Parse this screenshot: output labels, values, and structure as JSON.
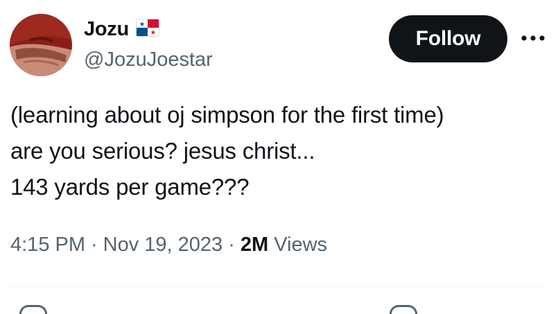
{
  "author": {
    "display_name": "Jozu",
    "handle": "@JozuJoestar",
    "flag_icon": "panama-flag-icon",
    "avatar_icon": "red-avatar-image"
  },
  "actions": {
    "follow_label": "Follow",
    "more_icon": "more-horizontal-icon"
  },
  "tweet": {
    "lines": [
      "(learning about oj simpson for the first time)",
      "are you serious? jesus christ...",
      "143 yards per game???"
    ]
  },
  "meta": {
    "time": "4:15 PM",
    "separator": "·",
    "date": "Nov 19, 2023",
    "views_count": "2M",
    "views_label": "Views"
  },
  "colors": {
    "text_primary": "#0f1419",
    "text_secondary": "#536471",
    "button_bg": "#0f1419",
    "button_text": "#ffffff",
    "divider": "#eff3f4"
  }
}
